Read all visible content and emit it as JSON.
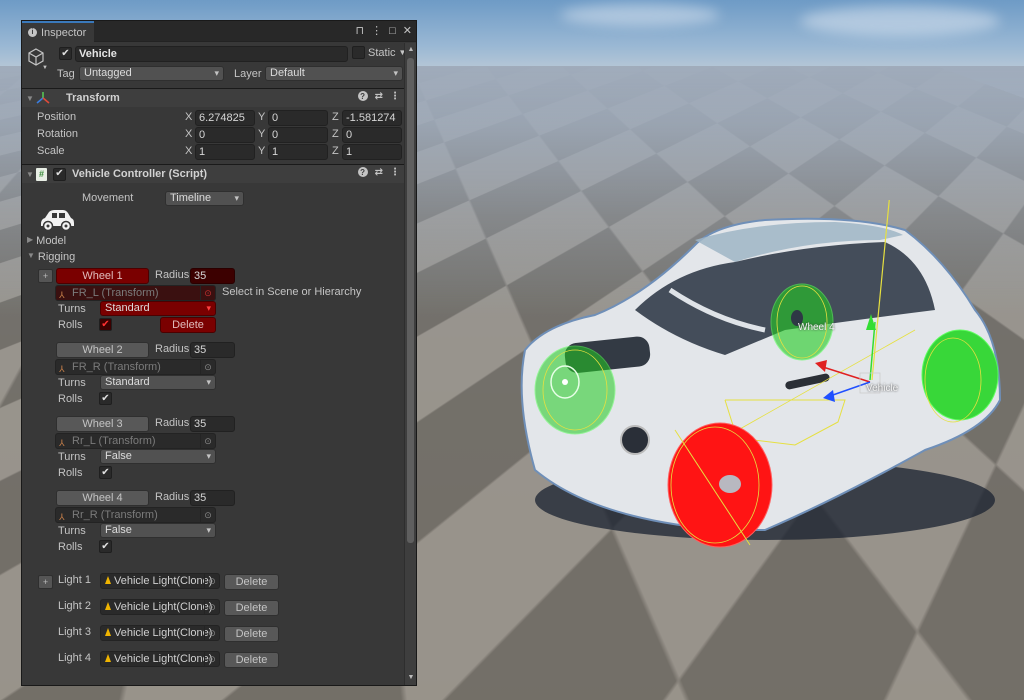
{
  "inspector": {
    "tab_label": "Inspector",
    "game_object": {
      "active": true,
      "name": "Vehicle",
      "static_label": "Static",
      "static": false,
      "tag_label": "Tag",
      "tag_value": "Untagged",
      "layer_label": "Layer",
      "layer_value": "Default"
    },
    "transform": {
      "title": "Transform",
      "rows": [
        {
          "label": "Position",
          "x": "6.274825",
          "y": "0",
          "z": "-1.581274"
        },
        {
          "label": "Rotation",
          "x": "0",
          "y": "0",
          "z": "0"
        },
        {
          "label": "Scale",
          "x": "1",
          "y": "1",
          "z": "1"
        }
      ],
      "axis_labels": [
        "X",
        "Y",
        "Z"
      ]
    },
    "vehicle_controller": {
      "title": "Vehicle Controller (Script)",
      "enabled": true,
      "movement_label": "Movement",
      "movement_value": "Timeline",
      "model_label": "Model",
      "rigging_label": "Rigging",
      "radius_label": "Radius",
      "turns_label": "Turns",
      "rolls_label": "Rolls",
      "delete_label": "Delete",
      "select_hint": "Select in Scene or Hierarchy",
      "wheels": [
        {
          "name": "Wheel 1",
          "radius": "35",
          "transform": "FR_L (Transform)",
          "turns": "Standard",
          "rolls": true,
          "selected": true
        },
        {
          "name": "Wheel 2",
          "radius": "35",
          "transform": "FR_R (Transform)",
          "turns": "Standard",
          "rolls": true,
          "selected": false
        },
        {
          "name": "Wheel 3",
          "radius": "35",
          "transform": "Rr_L (Transform)",
          "turns": "False",
          "rolls": true,
          "selected": false
        },
        {
          "name": "Wheel 4",
          "radius": "35",
          "transform": "Rr_R (Transform)",
          "turns": "False",
          "rolls": true,
          "selected": false
        }
      ],
      "lights": [
        {
          "label": "Light 1",
          "value": "Vehicle Light(Clone)"
        },
        {
          "label": "Light 2",
          "value": "Vehicle Light(Clone)"
        },
        {
          "label": "Light 3",
          "value": "Vehicle Light(Clone)"
        },
        {
          "label": "Light 4",
          "value": "Vehicle Light(Clone)"
        }
      ]
    }
  },
  "scene": {
    "labels": {
      "wheel4": "Wheel 4",
      "vehicle": "Vehicle"
    },
    "colors": {
      "selected_wheel": "#ff1a1a",
      "wheel_gizmo": "#22dd22",
      "axis_x": "#e02020",
      "axis_y": "#33dd33",
      "axis_z": "#2050ff",
      "bounds": "#e6e040"
    }
  },
  "icons": {
    "info": "i",
    "lock": "🔓",
    "more": "⋮",
    "maximize": "□",
    "close": "✕",
    "help": "?",
    "presets": "⇄",
    "check": "✔",
    "fold_open": "▼",
    "fold_closed": "▶",
    "plus": "+",
    "picker": "⊙"
  }
}
